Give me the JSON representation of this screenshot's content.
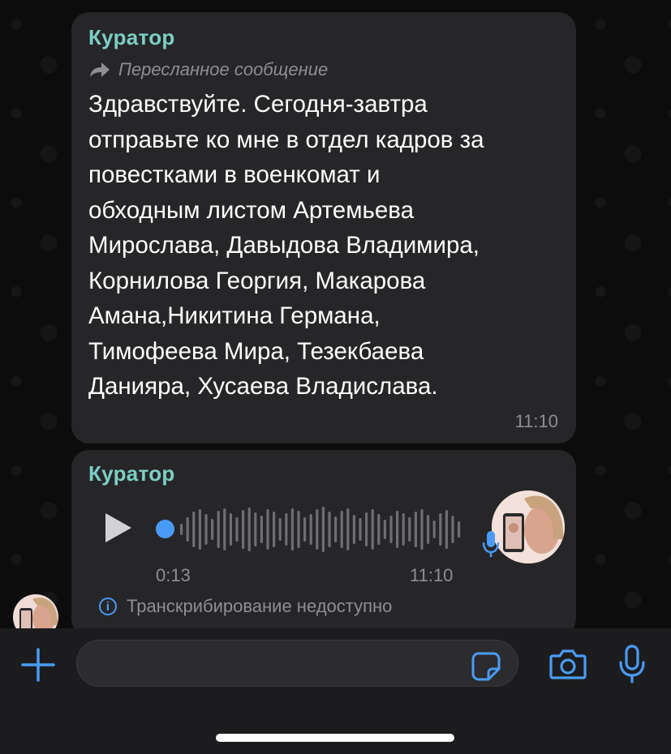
{
  "chat": {
    "messages": [
      {
        "sender": "Куратор",
        "forwarded_label": "Пересланное сообщение",
        "text": "Здравствуйте. Сегодня-завтра\nотправьте ко мне в отдел кадров за\nповестками в военкомат и\nобходным листом Артемьева\nМирослава, Давыдова Владимира,\nКорнилова Георгия, Макарова\nАмана,Никитина Германа,\nТимофеева Мира, Тезекбаева\nДанияра, Хусаева Владислава.",
        "time": "11:10"
      },
      {
        "sender": "Куратор",
        "voice": {
          "duration": "0:13",
          "time": "11:10",
          "progress": 0,
          "transcription_note": "Транскрибирование недоступно"
        }
      }
    ]
  },
  "composer": {
    "placeholder": "",
    "icons": [
      "plus-icon",
      "sticker-icon",
      "camera-icon",
      "microphone-icon"
    ]
  },
  "colors": {
    "sender": "#7ccfc3",
    "accent": "#4a9bf5",
    "bubble": "#262628",
    "muted": "#8e8e93"
  }
}
